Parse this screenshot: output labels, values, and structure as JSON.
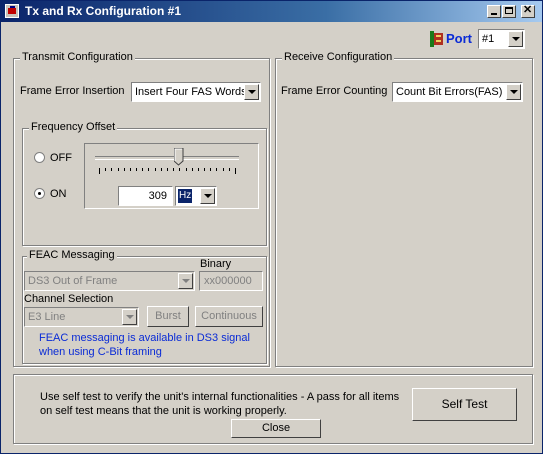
{
  "window": {
    "title": "Tx and Rx Configuration #1"
  },
  "port": {
    "label": "Port",
    "value": "#1"
  },
  "transmit": {
    "group_title": "Transmit Configuration",
    "frame_error_label": "Frame Error Insertion",
    "frame_error_value": "Insert Four FAS Words",
    "frequency": {
      "group_title": "Frequency Offset",
      "off_label": "OFF",
      "on_label": "ON",
      "selected": "ON",
      "slider_fraction": 0.59,
      "value": "309",
      "unit": "Hz"
    },
    "feac": {
      "group_title": "FEAC Messaging",
      "binary_label": "Binary",
      "message_value": "DS3 Out of Frame",
      "binary_value": "xx000000",
      "channel_label": "Channel Selection",
      "channel_value": "E3 Line",
      "burst_label": "Burst",
      "continuous_label": "Continuous",
      "note_line1": "FEAC messaging is available in DS3 signal",
      "note_line2": "when using C-Bit framing"
    }
  },
  "receive": {
    "group_title": "Receive Configuration",
    "frame_error_label": "Frame Error Counting",
    "frame_error_value": "Count Bit Errors(FAS)"
  },
  "selftest": {
    "text_line1": "Use self test to verify the unit's internal functionalities - A pass for all items",
    "text_line2": "on self test means that the unit is working properly.",
    "button_label": "Self Test"
  },
  "close_label": "Close",
  "colors": {
    "title_start": "#0a246a",
    "title_end": "#a6caf0",
    "note": "#0a2bd6"
  }
}
